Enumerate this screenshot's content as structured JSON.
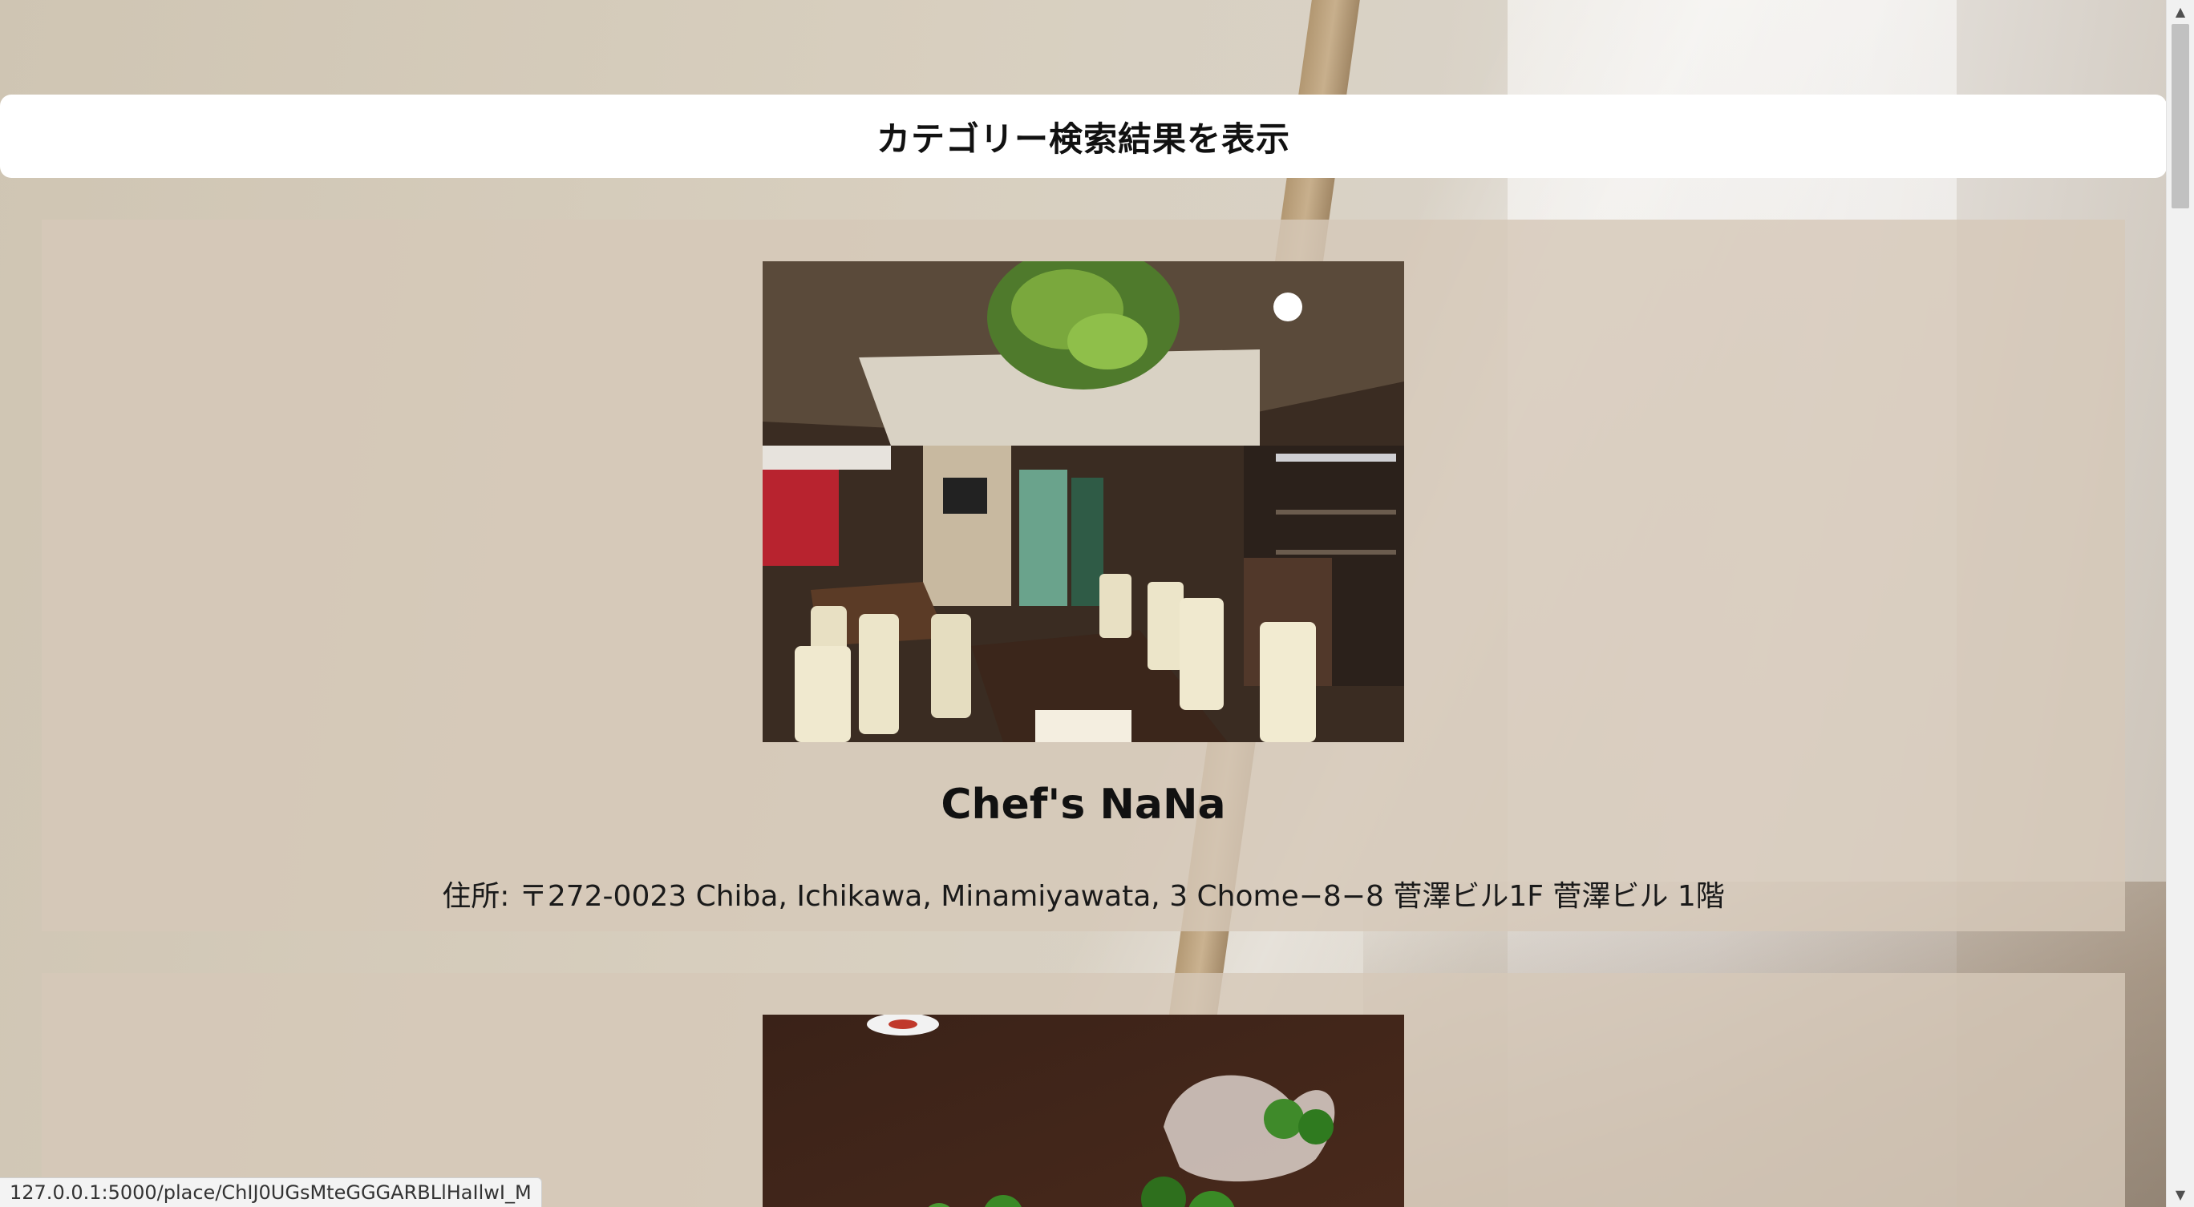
{
  "header": {
    "title": "カテゴリー検索結果を表示"
  },
  "results": [
    {
      "name": "Chef's NaNa",
      "address": "住所: 〒272-0023 Chiba, Ichikawa, Minamiyawata, 3 Chome−8−8 菅澤ビル1F 菅澤ビル 1階",
      "photo_icon": "restaurant-interior-photo"
    },
    {
      "name": "",
      "address": "",
      "photo_icon": "sashimi-dish-photo"
    }
  ],
  "status_bar": {
    "url": "127.0.0.1:5000/place/ChIJ0UGsMteGGGARBLlHaIlwI_M"
  },
  "scrollbar": {
    "up_icon": "▲",
    "down_icon": "▼"
  }
}
